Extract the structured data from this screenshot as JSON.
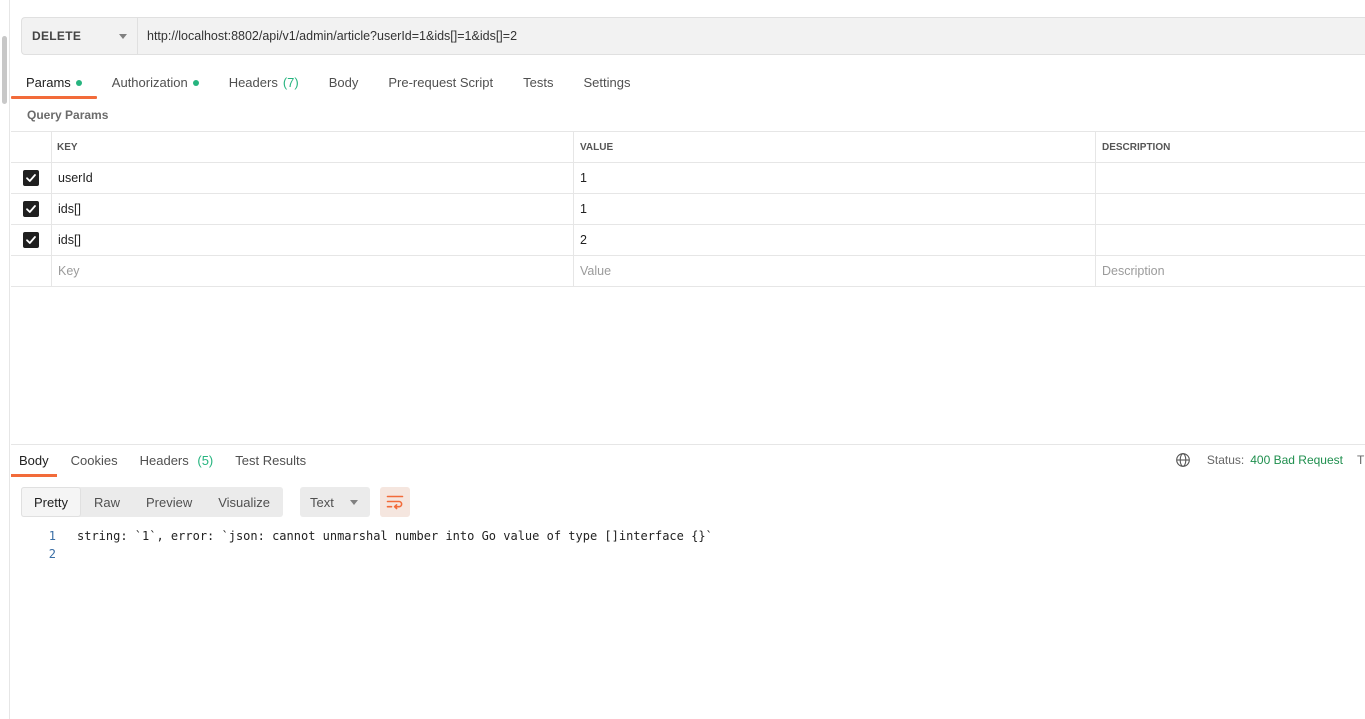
{
  "request": {
    "method": "DELETE",
    "url": "http://localhost:8802/api/v1/admin/article?userId=1&ids[]=1&ids[]=2"
  },
  "request_tabs": [
    {
      "label": "Params",
      "dot": true,
      "active": true
    },
    {
      "label": "Authorization",
      "dot": true
    },
    {
      "label": "Headers",
      "count": "(7)"
    },
    {
      "label": "Body"
    },
    {
      "label": "Pre-request Script"
    },
    {
      "label": "Tests"
    },
    {
      "label": "Settings"
    }
  ],
  "query_params": {
    "title": "Query Params",
    "columns": {
      "key": "KEY",
      "value": "VALUE",
      "description": "DESCRIPTION"
    },
    "rows": [
      {
        "key": "userId",
        "value": "1",
        "description": "",
        "checked": true
      },
      {
        "key": "ids[]",
        "value": "1",
        "description": "",
        "checked": true
      },
      {
        "key": "ids[]",
        "value": "2",
        "description": "",
        "checked": true
      }
    ],
    "placeholder": {
      "key": "Key",
      "value": "Value",
      "description": "Description"
    }
  },
  "response_tabs": [
    {
      "label": "Body",
      "active": true
    },
    {
      "label": "Cookies"
    },
    {
      "label": "Headers",
      "count": "(5)"
    },
    {
      "label": "Test Results"
    }
  ],
  "status": {
    "label": "Status:",
    "value": "400 Bad Request",
    "trailing": "T"
  },
  "view_modes": [
    "Pretty",
    "Raw",
    "Preview",
    "Visualize"
  ],
  "format": "Text",
  "response_body": {
    "lines": [
      {
        "num": "1",
        "text": "string: `1`, error: `json: cannot unmarshal number into Go value of type []interface {}`"
      },
      {
        "num": "2",
        "text": ""
      }
    ]
  },
  "colors": {
    "accent": "#f26b3a",
    "success": "#26b47f",
    "status_error_text": "#1f8f4e"
  },
  "icons": {
    "method_dropdown": "chevron-down-icon",
    "checkbox": "checkmark-icon",
    "globe": "globe-icon",
    "wrap": "wrap-lines-icon"
  }
}
